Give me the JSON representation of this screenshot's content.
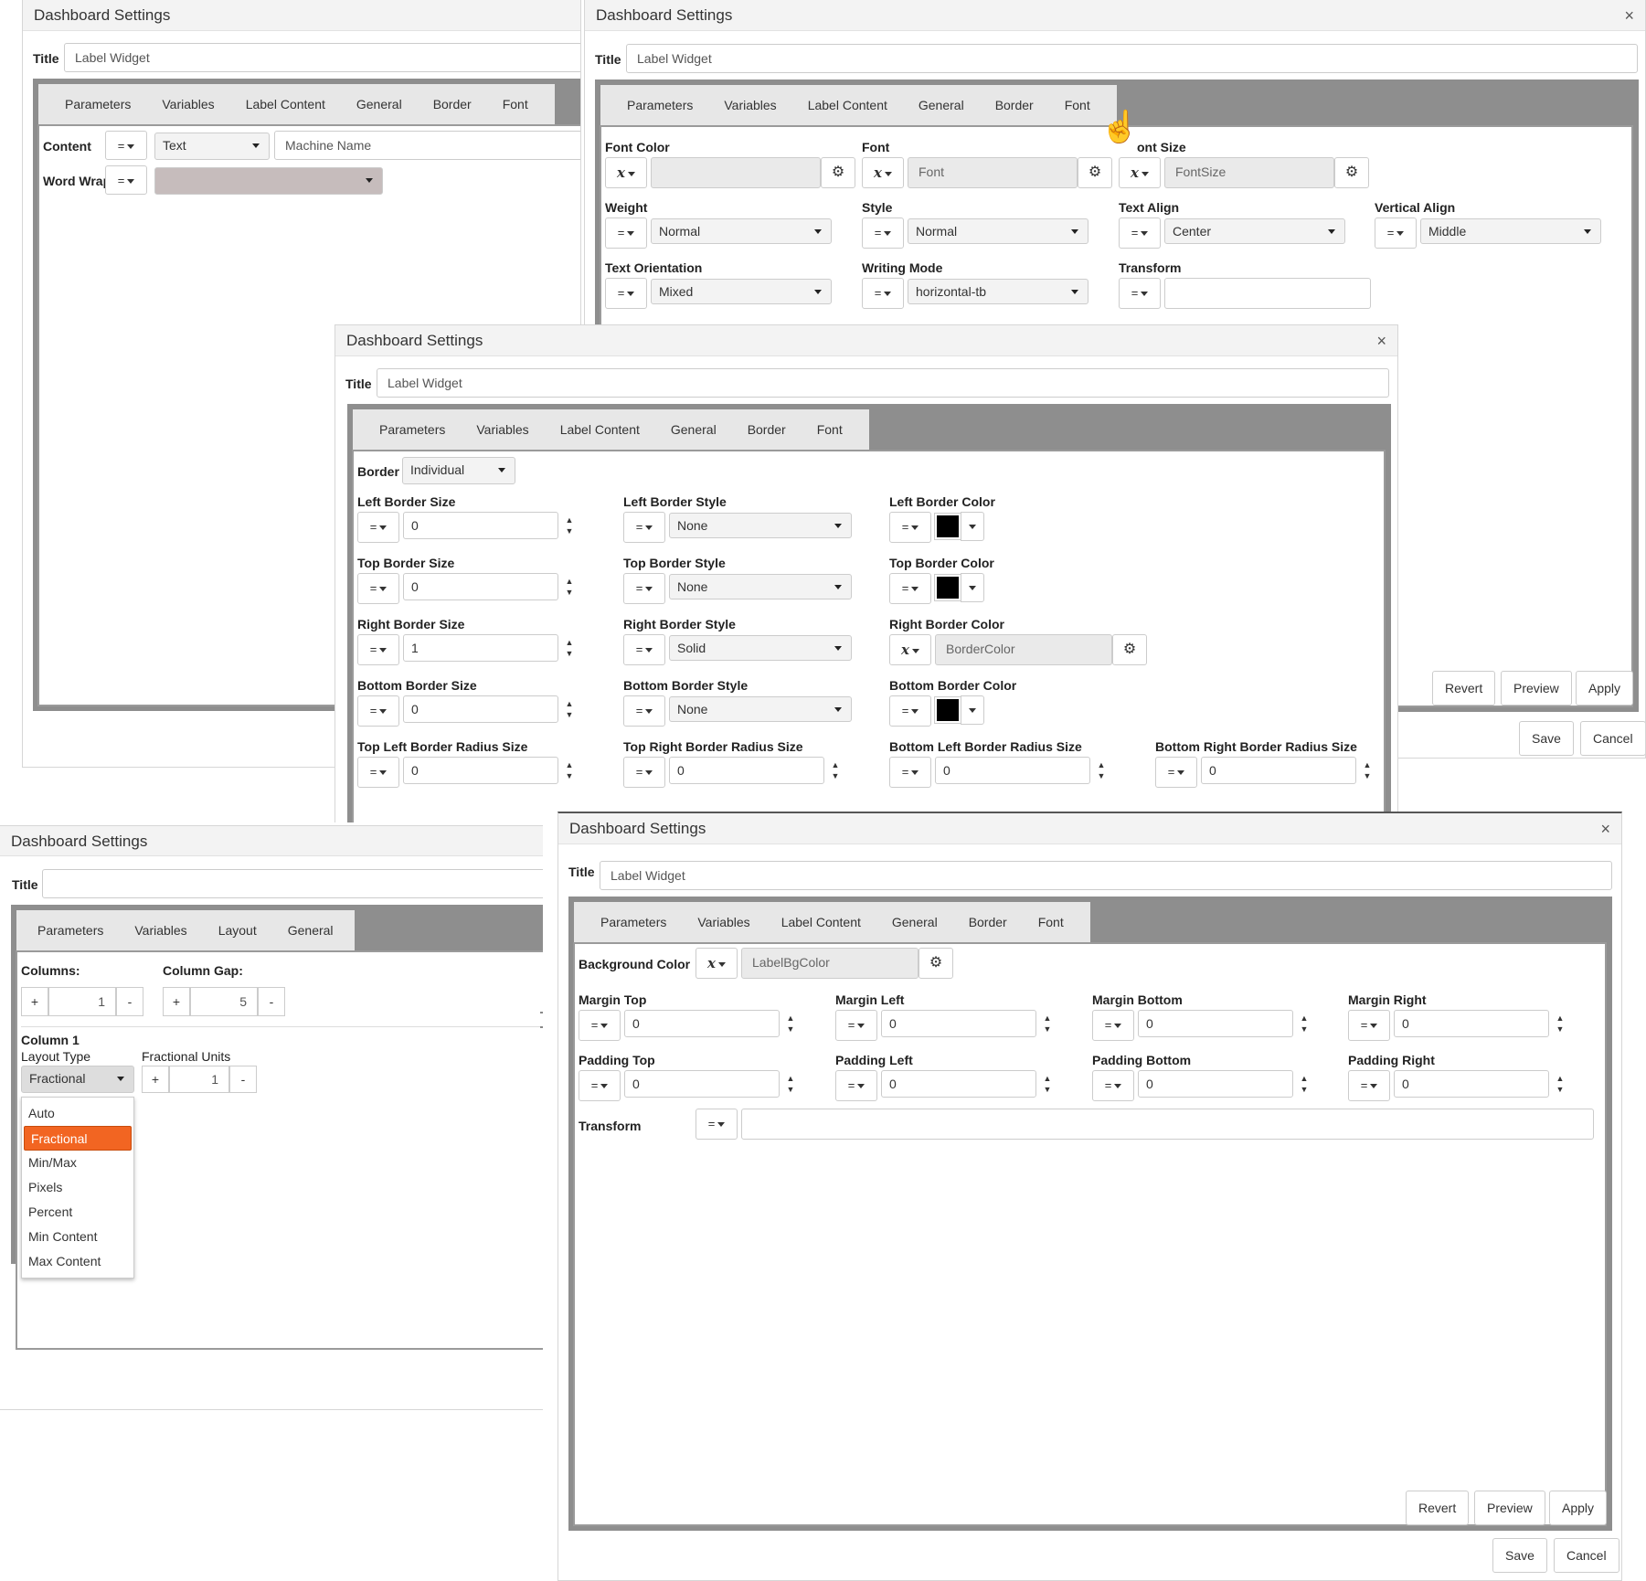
{
  "common": {
    "dialog_title": "Dashboard Settings",
    "title_label": "Title",
    "close_glyph": "×",
    "gear_glyph": "⚙",
    "eq_glyph": "=",
    "fx_glyph": "x",
    "up_glyph": "▲",
    "down_glyph": "▼",
    "revert": "Revert",
    "preview": "Preview",
    "apply": "Apply",
    "save": "Save",
    "cancel": "Cancel"
  },
  "d1": {
    "title_value": "Label Widget",
    "tabs": [
      "Parameters",
      "Variables",
      "Label Content",
      "General",
      "Border",
      "Font"
    ],
    "content_label": "Content",
    "content_type": "Text",
    "content_value": "Machine Name",
    "wordwrap_label": "Word Wrap"
  },
  "d2": {
    "title_value": "Label Widget",
    "tabs": [
      "Parameters",
      "Variables",
      "Label Content",
      "General",
      "Border",
      "Font"
    ],
    "font_color_label": "Font Color",
    "font_label": "Font",
    "font_placeholder": "Font",
    "font_size_label": "ont Size",
    "font_size_placeholder": "FontSize",
    "weight_label": "Weight",
    "weight_value": "Normal",
    "style_label": "Style",
    "style_value": "Normal",
    "text_align_label": "Text Align",
    "text_align_value": "Center",
    "vertical_align_label": "Vertical Align",
    "vertical_align_value": "Middle",
    "orientation_label": "Text Orientation",
    "orientation_value": "Mixed",
    "writing_mode_label": "Writing Mode",
    "writing_mode_value": "horizontal-tb",
    "transform_label": "Transform"
  },
  "d3": {
    "title_value": "Label Widget",
    "tabs": [
      "Parameters",
      "Variables",
      "Label Content",
      "General",
      "Border",
      "Font"
    ],
    "border_label": "Border",
    "border_value": "Individual",
    "left_size_label": "Left Border Size",
    "left_size": "0",
    "left_style_label": "Left Border Style",
    "left_style": "None",
    "left_color_label": "Left Border Color",
    "top_size_label": "Top Border Size",
    "top_size": "0",
    "top_style_label": "Top Border Style",
    "top_style": "None",
    "top_color_label": "Top Border Color",
    "right_size_label": "Right Border Size",
    "right_size": "1",
    "right_style_label": "Right Border Style",
    "right_style": "Solid",
    "right_color_label": "Right Border Color",
    "right_color_placeholder": "BorderColor",
    "bottom_size_label": "Bottom Border Size",
    "bottom_size": "0",
    "bottom_style_label": "Bottom Border Style",
    "bottom_style": "None",
    "bottom_color_label": "Bottom Border Color",
    "tl_radius_label": "Top Left Border Radius Size",
    "tl_radius": "0",
    "tr_radius_label": "Top Right Border Radius Size",
    "tr_radius": "0",
    "bl_radius_label": "Bottom Left Border Radius Size",
    "bl_radius": "0",
    "br_radius_label": "Bottom Right Border Radius Size",
    "br_radius": "0"
  },
  "d4": {
    "title_value": "",
    "tabs": [
      "Parameters",
      "Variables",
      "Layout",
      "General"
    ],
    "columns_label": "Columns:",
    "columns_value": "1",
    "gap_label": "Column Gap:",
    "gap_value": "5",
    "plus": "+",
    "minus": "-",
    "column_heading": "Column 1",
    "layout_type_label": "Layout Type",
    "layout_type_value": "Fractional",
    "fr_units_label": "Fractional Units",
    "fr_units_value": "1",
    "options": [
      "Auto",
      "Fractional",
      "Min/Max",
      "Pixels",
      "Percent",
      "Min Content",
      "Max Content"
    ],
    "selected_option": "Fractional"
  },
  "d5": {
    "title_value": "Label Widget",
    "tabs": [
      "Parameters",
      "Variables",
      "Label Content",
      "General",
      "Border",
      "Font"
    ],
    "bg_label": "Background Color",
    "bg_placeholder": "LabelBgColor",
    "margin_top_label": "Margin Top",
    "margin_top": "0",
    "margin_left_label": "Margin Left",
    "margin_left": "0",
    "margin_bottom_label": "Margin Bottom",
    "margin_bottom": "0",
    "margin_right_label": "Margin Right",
    "margin_right": "0",
    "padding_top_label": "Padding Top",
    "padding_top": "0",
    "padding_left_label": "Padding Left",
    "padding_left": "0",
    "padding_bottom_label": "Padding Bottom",
    "padding_bottom": "0",
    "padding_right_label": "Padding Right",
    "padding_right": "0",
    "transform_label": "Transform"
  },
  "colors": {
    "tab_bar": "#8e8e8e",
    "selected_option": "#f26522",
    "swatch": "#000000"
  }
}
